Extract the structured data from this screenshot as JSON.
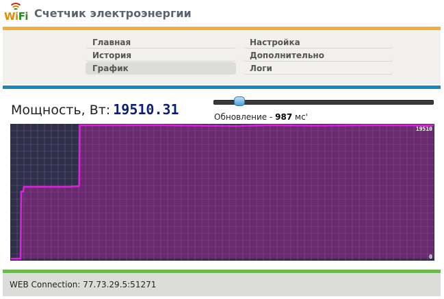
{
  "header": {
    "logo_text_wi": "Wi",
    "logo_text_fi": "Fi",
    "title": "Счетчик электроэнергии"
  },
  "menu": {
    "left": [
      {
        "label": "Главная",
        "active": false
      },
      {
        "label": "История",
        "active": false
      },
      {
        "label": "График",
        "active": true
      }
    ],
    "right": [
      {
        "label": "Настройка",
        "active": false
      },
      {
        "label": "Дополнительно",
        "active": false
      },
      {
        "label": "Логи",
        "active": false
      }
    ]
  },
  "power": {
    "label": "Мощность, Вт:",
    "value": "19510.31"
  },
  "refresh": {
    "prefix": "Обновление - ",
    "value": "987",
    "unit": " мс'",
    "slider_fraction": 0.1
  },
  "chart_data": {
    "type": "line",
    "ylim": [
      0,
      19510
    ],
    "y_max_label": "19510",
    "y_min_label": "0",
    "grid": true,
    "colors": {
      "line": "#e020e0",
      "fill": "#6a2a6e",
      "background": "#2d3048",
      "grid": "#8e5aa0"
    },
    "points": [
      [
        0,
        0
      ],
      [
        14,
        0
      ],
      [
        15,
        9800
      ],
      [
        18,
        9800
      ],
      [
        19,
        10500
      ],
      [
        85,
        10500
      ],
      [
        100,
        10600
      ],
      [
        101,
        19500
      ],
      [
        220,
        19510
      ],
      [
        330,
        19400
      ],
      [
        380,
        19510
      ],
      [
        450,
        19450
      ],
      [
        530,
        19510
      ],
      [
        600,
        19480
      ],
      [
        620,
        19510
      ]
    ]
  },
  "footer": {
    "text": "WEB Connection: 77.73.29.5:51271"
  }
}
